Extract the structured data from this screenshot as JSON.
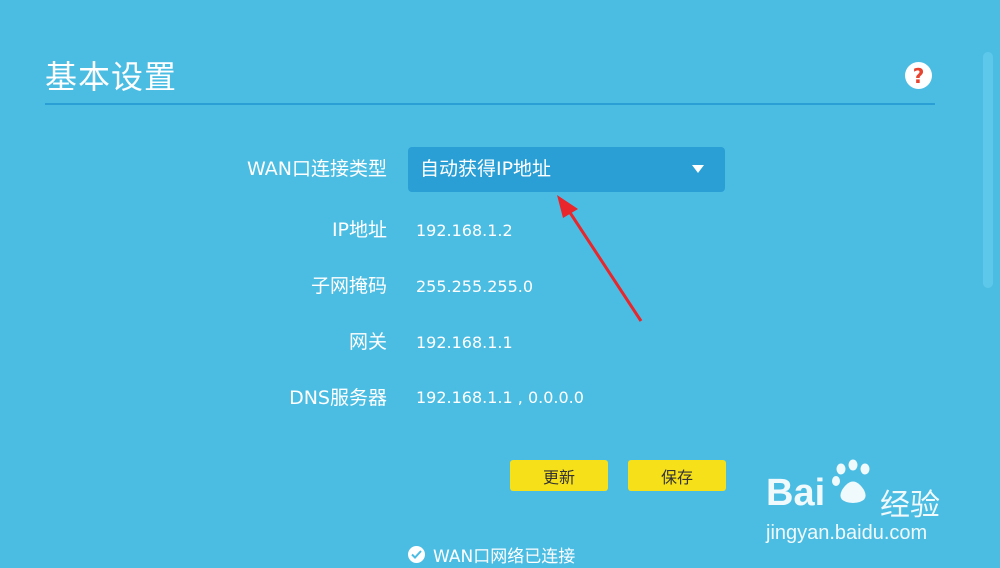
{
  "page": {
    "title": "基本设置",
    "help_icon": "question-circle-icon",
    "colors": {
      "background": "#4bbde3",
      "accent": "#2a9fd6",
      "button": "#f6e01a",
      "help_mark": "#e8432f",
      "annotation_arrow": "#e8262b"
    }
  },
  "form": {
    "wan_type": {
      "label": "WAN口连接类型",
      "value": "自动获得IP地址",
      "icon": "chevron-down-icon"
    },
    "ip": {
      "label": "IP地址",
      "value": "192.168.1.2"
    },
    "mask": {
      "label": "子网掩码",
      "value": "255.255.255.0"
    },
    "gateway": {
      "label": "网关",
      "value": "192.168.1.1"
    },
    "dns": {
      "label": "DNS服务器",
      "value": "192.168.1.1 , 0.0.0.0"
    }
  },
  "buttons": {
    "refresh": "更新",
    "save": "保存"
  },
  "status": {
    "text": "WAN口网络已连接",
    "icon": "check-circle-icon"
  },
  "watermark": {
    "brand_left": "Bai",
    "brand_right": "经验",
    "url": "jingyan.baidu.com",
    "icon": "paw-icon"
  }
}
